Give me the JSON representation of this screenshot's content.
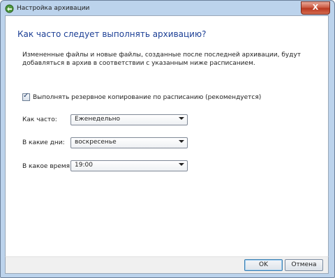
{
  "window": {
    "title": "Настройка архивации",
    "close_label": "X"
  },
  "main": {
    "heading": "Как часто следует выполнять архивацию?",
    "description": "Измененные файлы и новые файлы, созданные после последней архивации, будут добавляться в архив в соответствии с указанным ниже расписанием.",
    "schedule_checkbox": {
      "label": "Выполнять резервное копирование по расписанию (рекомендуется)",
      "checked": true
    },
    "fields": [
      {
        "label": "Как часто:",
        "value": "Еженедельно"
      },
      {
        "label": "В какие дни:",
        "value": "воскресенье"
      },
      {
        "label": "В какое время:",
        "value": "19:00"
      }
    ]
  },
  "footer": {
    "ok_label": "OK",
    "cancel_label": "Отмена"
  }
}
